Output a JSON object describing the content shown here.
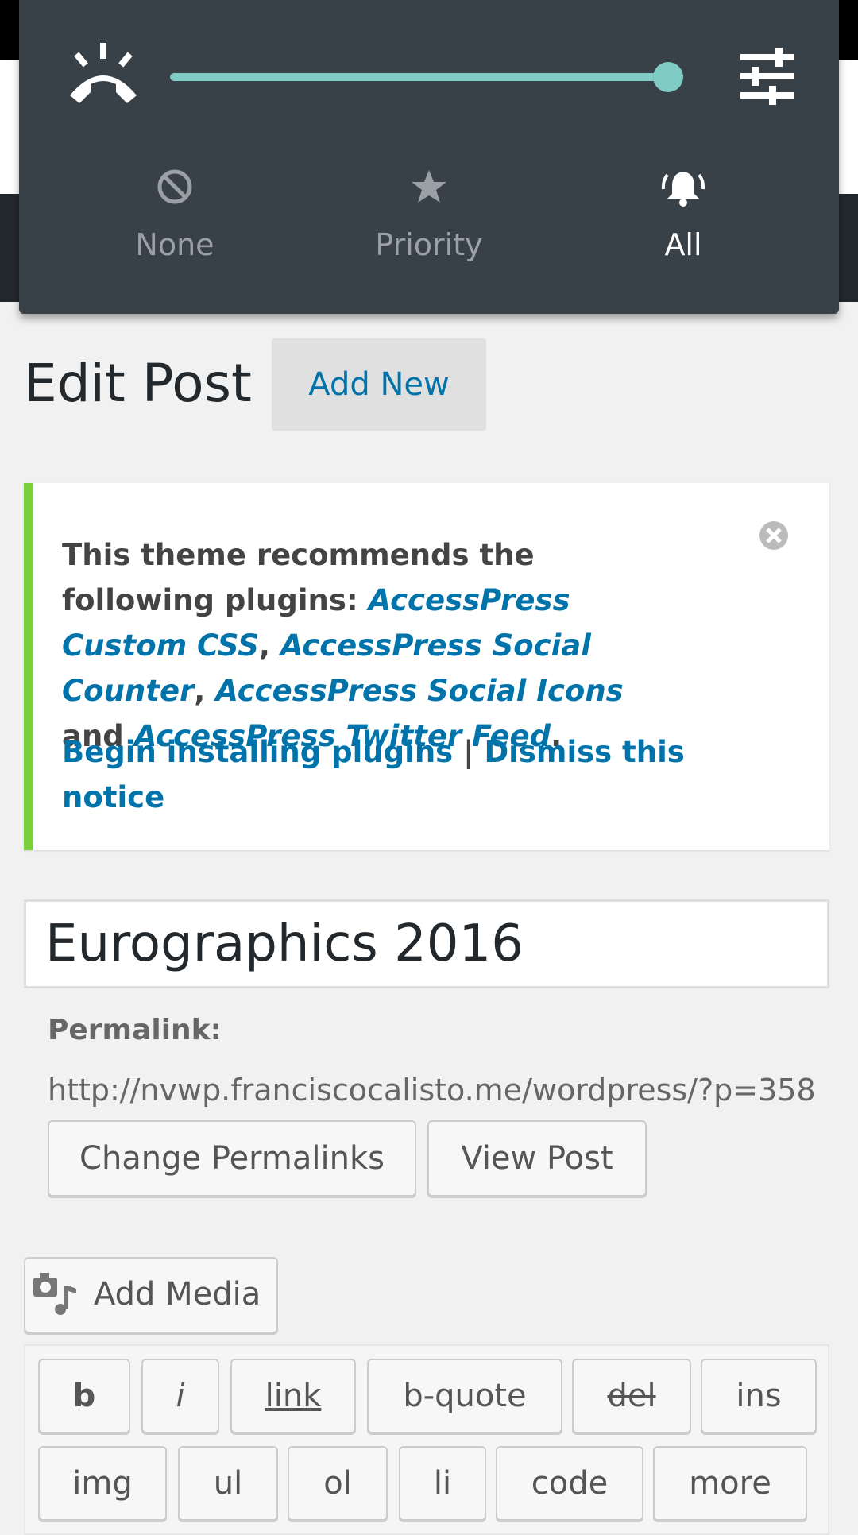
{
  "shade": {
    "volume_level": 1.0,
    "modes": [
      {
        "label": "None",
        "icon": "block-icon",
        "active": false
      },
      {
        "label": "Priority",
        "icon": "star-icon",
        "active": false
      },
      {
        "label": "All",
        "icon": "bell-icon",
        "active": true
      }
    ]
  },
  "page": {
    "title": "Edit Post",
    "add_new_label": "Add New"
  },
  "notice": {
    "intro": "This theme recommends the following plugins: ",
    "plugins": [
      "AccessPress Custom CSS",
      "AccessPress Social Counter",
      "AccessPress Social Icons",
      "AccessPress Twitter Feed"
    ],
    "sep1": ", ",
    "sep2": ", ",
    "sep3": " and ",
    "end": ".",
    "begin_installing": "Begin installing plugins",
    "divider": " | ",
    "dismiss": "Dismiss this notice"
  },
  "post": {
    "title_value": "Eurographics 2016",
    "permalink_label": "Permalink:",
    "permalink_url": "http://nvwp.franciscocalisto.me/wordpress/?p=358",
    "change_permalinks_label": "Change Permalinks",
    "view_post_label": "View Post",
    "add_media_label": "Add Media"
  },
  "quicktags": {
    "row1": [
      "b",
      "i",
      "link",
      "b-quote",
      "del",
      "ins"
    ],
    "row2": [
      "img",
      "ul",
      "ol",
      "li",
      "code",
      "more"
    ]
  },
  "colors": {
    "accent_teal": "#80cbc4",
    "shade_bg": "#384048",
    "link_blue": "#0073aa",
    "notice_green": "#7ad03a"
  }
}
